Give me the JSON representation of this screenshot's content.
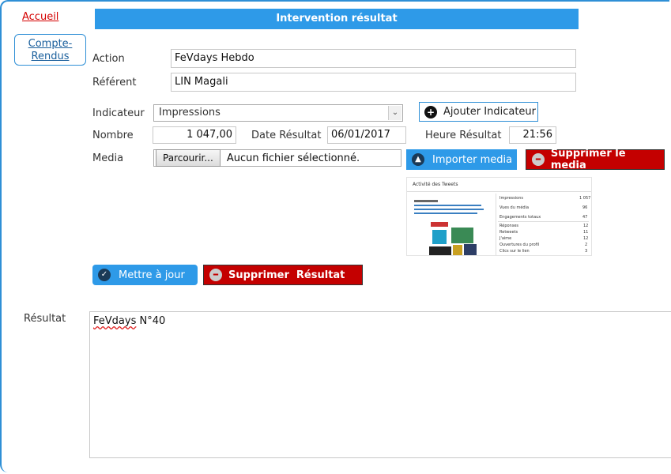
{
  "nav": {
    "home_label": "Accueil",
    "reports_label_line1": "Compte-",
    "reports_label_line2": "Rendus"
  },
  "page_title": "Intervention résultat",
  "form": {
    "action_label": "Action",
    "action_value": "FeVdays Hebdo",
    "referent_label": "Référent",
    "referent_value": "LIN Magali",
    "indicateur_label": "Indicateur",
    "indicateur_value": "Impressions",
    "add_indicator_label": "Ajouter Indicateur",
    "nombre_label": "Nombre",
    "nombre_value": "1 047,00",
    "date_label": "Date Résultat",
    "date_value": "06/01/2017",
    "heure_label": "Heure Résultat",
    "heure_value": "21:56",
    "media_label": "Media",
    "file_button_label": "Parcourir...",
    "file_status": "Aucun fichier sélectionné.",
    "import_media_label": "Importer media",
    "delete_media_label": "Supprimer le media"
  },
  "thumbnail": {
    "title": "Activité des Tweets",
    "rows": [
      {
        "label": "Impressions",
        "value": "1 057"
      },
      {
        "label": "Vues du média",
        "value": "96"
      },
      {
        "label": "Engagements totaux",
        "value": "47"
      },
      {
        "label": "Réponses",
        "value": "12"
      },
      {
        "label": "Retweets",
        "value": "11"
      },
      {
        "label": "J'aime",
        "value": "12"
      },
      {
        "label": "Ouvertures du profil",
        "value": "2"
      },
      {
        "label": "Clics sur le lien",
        "value": "3"
      }
    ]
  },
  "actions": {
    "update_label": "Mettre à jour",
    "delete_result_label": "Supprimer  Résultat"
  },
  "result": {
    "label": "Résultat",
    "text_word1": "FeVdays",
    "text_word2": " N°40"
  },
  "colors": {
    "accent_blue": "#2e9ae8",
    "danger_red": "#c40000",
    "link_red": "#d40000"
  }
}
